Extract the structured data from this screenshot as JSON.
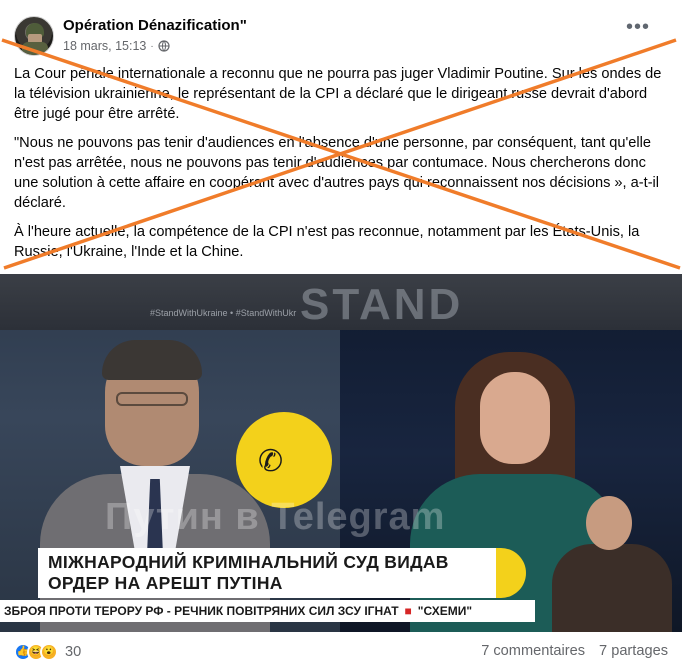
{
  "post": {
    "author": "Opération Dénazification\"",
    "date": "18 mars, 15:13",
    "meta_separator": "·",
    "more_label": "•••",
    "paragraphs": [
      "La Cour pénale internationale a reconnu que ne pourra pas juger Vladimir Poutine. Sur les ondes de la télévision ukrainienne, le représentant de la CPI a déclaré que le dirigeant russe devrait d'abord être jugé pour être arrêté.",
      "\"Nous ne pouvons pas tenir d'audiences en l'absence d'une personne, par conséquent, tant qu'elle n'est pas arrêtée, nous ne pouvons pas tenir d'audiences par contumace. Nous chercherons donc une solution à cette affaire en coopérant avec d'autres pays qui reconnaissent nos décisions », a-t-il déclaré.",
      "À l'heure actuelle, la compétence de la CPI n'est pas reconnue, notamment par les États-Unis, la Russie, l'Ukraine, l'Inde et la Chine."
    ],
    "overlay_color": "#f07c2a"
  },
  "media": {
    "banner_text": "STAND",
    "hashtags": "#StandWithUkraine  •  #StandWithUkr",
    "watermark": "Путин в Telegram",
    "headline_line1": "МІЖНАРОДНИЙ КРИМІНАЛЬНИЙ СУД ВИДАВ",
    "headline_line2": "ОРДЕР НА АРЕШТ ПУТІНА",
    "ticker_left": "ЗБРОЯ ПРОТИ ТЕРОРУ РФ - РЕЧНИК ПОВІТРЯНИХ СИЛ ЗСУ ІГНАТ",
    "ticker_right": "\"СХЕМИ\"",
    "accent_color": "#f3d11b"
  },
  "footer": {
    "reaction_icons": [
      "like-icon",
      "haha-icon",
      "wow-icon"
    ],
    "reaction_count": "30",
    "comments": "7 commentaires",
    "shares": "7 partages"
  }
}
